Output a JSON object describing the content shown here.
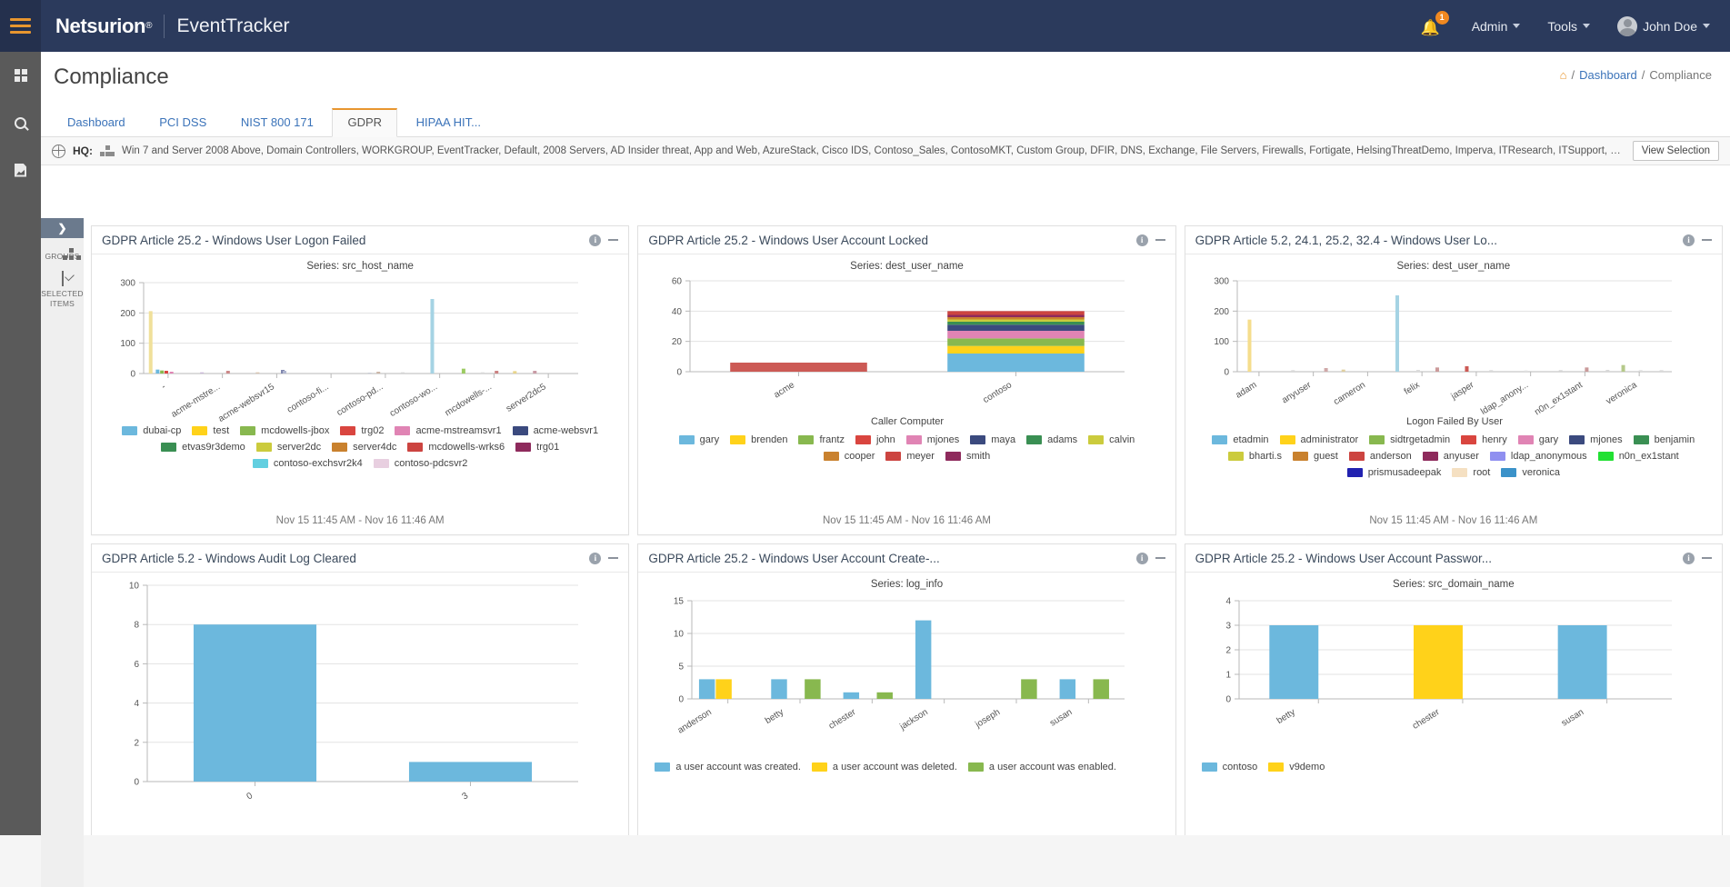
{
  "topbar": {
    "brand": "Netsurion",
    "brand_reg": "®",
    "product": "EventTracker",
    "notification_count": "1",
    "admin_label": "Admin",
    "tools_label": "Tools",
    "user_label": "John Doe"
  },
  "page": {
    "title": "Compliance",
    "breadcrumb_home": "⌂",
    "breadcrumb_sep1": "/",
    "breadcrumb_dashboard": "Dashboard",
    "breadcrumb_sep2": "/",
    "breadcrumb_current": "Compliance"
  },
  "tabs": [
    {
      "label": "Dashboard",
      "active": false
    },
    {
      "label": "PCI DSS",
      "active": false
    },
    {
      "label": "NIST 800 171",
      "active": false
    },
    {
      "label": "GDPR",
      "active": true
    },
    {
      "label": "HIPAA HIT...",
      "active": false
    }
  ],
  "filterbar": {
    "hq_label": "HQ:",
    "groups": "Win 7 and Server 2008 Above, Domain Controllers, WORKGROUP, EventTracker, Default, 2008 Servers, AD Insider threat, App and Web, AzureStack, Cisco IDS, Contoso_Sales, ContosoMKT, Custom Group, DFIR, DNS, Exchange, File Servers, Firewalls, Fortigate, HelsingThreatDemo, Imperva, ITResearch, ITSupport, Li...",
    "view_selection": "View Selection"
  },
  "subrail": {
    "expand": "❯",
    "groups_label": "GROUPS",
    "selected_items_label_1": "SELECTED",
    "selected_items_label_2": "ITEMS"
  },
  "colors": {
    "accent": "#e8962f",
    "navy": "#2b3a5c",
    "link": "#3b73b9",
    "blue": "#6cb8dd",
    "yellow": "#ffd21a"
  },
  "chart_data": [
    {
      "id": "w1",
      "type": "bar",
      "title": "GDPR Article 25.2 - Windows User Logon Failed",
      "subtitle": "Series: src_host_name",
      "xlabel": "",
      "ylabel": "",
      "ylim": [
        0,
        300
      ],
      "yticks": [
        0,
        100,
        200,
        300
      ],
      "grid": true,
      "legend_position": "bottom",
      "xticklabels": [
        "-",
        "acme-mstre...",
        "acme-websvr15",
        "contoso-fi...",
        "contoso-pd...",
        "contoso-wo...",
        "mcdowells-...",
        "server2dc5"
      ],
      "legend": [
        {
          "label": "dubai-cp",
          "color": "#6cb8dd"
        },
        {
          "label": "test",
          "color": "#ffd21a"
        },
        {
          "label": "mcdowells-jbox",
          "color": "#88b84f"
        },
        {
          "label": "trg02",
          "color": "#d9453f"
        },
        {
          "label": "acme-mstreamsvr1",
          "color": "#e084b4"
        },
        {
          "label": "acme-websvr1",
          "color": "#3b4a7e"
        },
        {
          "label": "etvas9r3demo",
          "color": "#3a8f53"
        },
        {
          "label": "server2dc",
          "color": "#cbcb3d"
        },
        {
          "label": "server4dc",
          "color": "#c9812e"
        },
        {
          "label": "mcdowells-wrks6",
          "color": "#cc4440"
        },
        {
          "label": "trg01",
          "color": "#8e2a5c"
        },
        {
          "label": "contoso-exchsvr2k4",
          "color": "#62cfe0"
        },
        {
          "label": "contoso-pdcsvr2",
          "color": "#e8cfe0"
        }
      ],
      "bars": [
        {
          "x": 6,
          "value": 206,
          "color": "#f0e09a"
        },
        {
          "x": 14,
          "value": 13,
          "color": "#6cb8dd"
        },
        {
          "x": 19,
          "value": 10,
          "color": "#88b84f"
        },
        {
          "x": 24,
          "value": 9,
          "color": "#d9453f"
        },
        {
          "x": 30,
          "value": 6,
          "color": "#e084b4"
        },
        {
          "x": 65,
          "value": 4,
          "color": "#c9b8d8"
        },
        {
          "x": 95,
          "value": 9,
          "color": "#cc8888"
        },
        {
          "x": 129,
          "value": 4,
          "color": "#d8c4b0"
        },
        {
          "x": 158,
          "value": 12,
          "color": "#7d84ad"
        },
        {
          "x": 160,
          "value": 9,
          "color": "#b0b6cf"
        },
        {
          "x": 218,
          "value": 3,
          "color": "#dcdcdc"
        },
        {
          "x": 258,
          "value": 3,
          "color": "#c9cdd8"
        },
        {
          "x": 268,
          "value": 6,
          "color": "#cbb6a8"
        },
        {
          "x": 296,
          "value": 4,
          "color": "#d5d5d5"
        },
        {
          "x": 330,
          "value": 246,
          "color": "#a5d3e4"
        },
        {
          "x": 366,
          "value": 16,
          "color": "#9ccb63"
        },
        {
          "x": 388,
          "value": 4,
          "color": "#d8d8d8"
        },
        {
          "x": 404,
          "value": 9,
          "color": "#cc8282"
        },
        {
          "x": 425,
          "value": 8,
          "color": "#e8d48a"
        },
        {
          "x": 448,
          "value": 9,
          "color": "#c99ba5"
        }
      ],
      "timerange": "Nov 15 11:45 AM - Nov 16 11:46 AM"
    },
    {
      "id": "w2",
      "type": "bar",
      "stacked": true,
      "title": "GDPR Article 25.2 - Windows User Account Locked",
      "subtitle": "Series: dest_user_name",
      "xlabel": "Caller Computer",
      "ylabel": "",
      "ylim": [
        0,
        60
      ],
      "yticks": [
        0,
        20,
        40,
        60
      ],
      "grid": true,
      "legend_position": "bottom",
      "categories": [
        "acme",
        "contoso"
      ],
      "legend": [
        {
          "label": "gary",
          "color": "#6cb8dd"
        },
        {
          "label": "brenden",
          "color": "#ffd21a"
        },
        {
          "label": "frantz",
          "color": "#88b84f"
        },
        {
          "label": "john",
          "color": "#d9453f"
        },
        {
          "label": "mjones",
          "color": "#e084b4"
        },
        {
          "label": "maya",
          "color": "#3b4a7e"
        },
        {
          "label": "adams",
          "color": "#3a8f53"
        },
        {
          "label": "calvin",
          "color": "#cbcb3d"
        },
        {
          "label": "cooper",
          "color": "#c9812e"
        },
        {
          "label": "meyer",
          "color": "#cc4440"
        },
        {
          "label": "smith",
          "color": "#8e2a5c"
        }
      ],
      "series": [
        {
          "name": "acme",
          "segments": [
            {
              "label": "john",
              "color": "#cc5a55",
              "value": 6
            }
          ]
        },
        {
          "name": "contoso",
          "segments": [
            {
              "label": "gary",
              "color": "#6cb8dd",
              "value": 12
            },
            {
              "label": "brenden",
              "color": "#ffd21a",
              "value": 5
            },
            {
              "label": "frantz",
              "color": "#88b84f",
              "value": 5
            },
            {
              "label": "mjones",
              "color": "#e084b4",
              "value": 5
            },
            {
              "label": "maya",
              "color": "#3b4a7e",
              "value": 4
            },
            {
              "label": "adams",
              "color": "#3a8f53",
              "value": 2
            },
            {
              "label": "calvin",
              "color": "#cbcb3d",
              "value": 1.5
            },
            {
              "label": "cooper",
              "color": "#c9812e",
              "value": 1.5
            },
            {
              "label": "smith",
              "color": "#8e2a5c",
              "value": 1.5
            },
            {
              "label": "meyer",
              "color": "#cc4440",
              "value": 2.5
            }
          ]
        }
      ],
      "timerange": "Nov 15 11:45 AM - Nov 16 11:46 AM"
    },
    {
      "id": "w3",
      "type": "bar",
      "title": "GDPR Article 5.2, 24.1, 25.2, 32.4 - Windows User Lo...",
      "subtitle": "Series: dest_user_name",
      "xlabel": "Logon Failed By User",
      "ylabel": "",
      "ylim": [
        0,
        300
      ],
      "yticks": [
        0,
        100,
        200,
        300
      ],
      "grid": true,
      "legend_position": "bottom",
      "xticklabels": [
        "adam",
        "anyuser",
        "cameron",
        "felix",
        "jasper",
        "ldap_anony...",
        "n0n_ex1stant",
        "veronica"
      ],
      "legend": [
        {
          "label": "etadmin",
          "color": "#6cb8dd"
        },
        {
          "label": "administrator",
          "color": "#ffd21a"
        },
        {
          "label": "sidtrgetadmin",
          "color": "#88b84f"
        },
        {
          "label": "henry",
          "color": "#d9453f"
        },
        {
          "label": "gary",
          "color": "#e084b4"
        },
        {
          "label": "mjones",
          "color": "#3b4a7e"
        },
        {
          "label": "benjamin",
          "color": "#3a8f53"
        },
        {
          "label": "bharti.s",
          "color": "#cbcb3d"
        },
        {
          "label": "guest",
          "color": "#c9812e"
        },
        {
          "label": "anderson",
          "color": "#cc4440"
        },
        {
          "label": "anyuser",
          "color": "#8e2a5c"
        },
        {
          "label": "ldap_anonymous",
          "color": "#8f8ff0"
        },
        {
          "label": "n0n_ex1stant",
          "color": "#22e033"
        },
        {
          "label": "prismusadeepak",
          "color": "#2222b0"
        },
        {
          "label": "root",
          "color": "#f5e0c2"
        },
        {
          "label": "veronica",
          "color": "#3b92c9"
        }
      ],
      "bars": [
        {
          "x": 12,
          "value": 172,
          "color": "#f5dd8c"
        },
        {
          "x": 62,
          "value": 5,
          "color": "#d8d8d8"
        },
        {
          "x": 100,
          "value": 12,
          "color": "#cfa8a8"
        },
        {
          "x": 120,
          "value": 7,
          "color": "#e0cfa0"
        },
        {
          "x": 182,
          "value": 252,
          "color": "#a5d3e4"
        },
        {
          "x": 206,
          "value": 6,
          "color": "#dcdcdc"
        },
        {
          "x": 228,
          "value": 14,
          "color": "#cc9a9a"
        },
        {
          "x": 262,
          "value": 18,
          "color": "#cc5a55"
        },
        {
          "x": 290,
          "value": 5,
          "color": "#d8d8d8"
        },
        {
          "x": 330,
          "value": 4,
          "color": "#e0e0e0"
        },
        {
          "x": 370,
          "value": 5,
          "color": "#d4d4d4"
        },
        {
          "x": 400,
          "value": 14,
          "color": "#c99a9a"
        },
        {
          "x": 424,
          "value": 6,
          "color": "#d8d8d8"
        },
        {
          "x": 442,
          "value": 22,
          "color": "#b5c98a"
        },
        {
          "x": 462,
          "value": 5,
          "color": "#dcdcdc"
        },
        {
          "x": 486,
          "value": 5,
          "color": "#d8d8d8"
        }
      ],
      "timerange": "Nov 15 11:45 AM - Nov 16 11:46 AM"
    },
    {
      "id": "w4",
      "type": "bar",
      "title": "GDPR Article 5.2 - Windows Audit Log Cleared",
      "subtitle": "",
      "xlabel": "",
      "ylabel": "",
      "ylim": [
        0,
        10
      ],
      "yticks": [
        0,
        2,
        4,
        6,
        8,
        10
      ],
      "grid": true,
      "legend_position": "none",
      "categories": [
        "0",
        "3"
      ],
      "values": [
        8,
        1
      ],
      "bar_color": "#6cb8dd",
      "legend": []
    },
    {
      "id": "w5",
      "type": "bar",
      "grouped": true,
      "title": "GDPR Article 25.2 - Windows User Account Create-...",
      "subtitle": "Series: log_info",
      "xlabel": "",
      "ylabel": "",
      "ylim": [
        0,
        15
      ],
      "yticks": [
        0,
        5,
        10,
        15
      ],
      "grid": true,
      "legend_position": "bottom",
      "categories": [
        "anderson",
        "betty",
        "chester",
        "jackson",
        "joseph",
        "susan"
      ],
      "legend": [
        {
          "label": "a user account was created.",
          "color": "#6cb8dd"
        },
        {
          "label": "a user account was deleted.",
          "color": "#ffd21a"
        },
        {
          "label": "a user account was enabled.",
          "color": "#88b84f"
        }
      ],
      "series": [
        {
          "name": "a user account was created.",
          "color": "#6cb8dd",
          "values": [
            3,
            3,
            1,
            12,
            0,
            3
          ]
        },
        {
          "name": "a user account was deleted.",
          "color": "#ffd21a",
          "values": [
            3,
            0,
            0,
            0,
            0,
            0
          ]
        },
        {
          "name": "a user account was enabled.",
          "color": "#88b84f",
          "values": [
            0,
            3,
            1,
            0,
            3,
            3
          ]
        }
      ]
    },
    {
      "id": "w6",
      "type": "bar",
      "title": "GDPR Article 25.2 - Windows User Account Passwor...",
      "subtitle": "Series: src_domain_name",
      "xlabel": "",
      "ylabel": "",
      "ylim": [
        0,
        4
      ],
      "yticks": [
        0,
        1,
        2,
        3,
        4
      ],
      "grid": true,
      "legend_position": "bottom",
      "categories": [
        "betty",
        "chester",
        "susan"
      ],
      "values": [
        3,
        3,
        3
      ],
      "bar_colors": [
        "#6cb8dd",
        "#ffd21a",
        "#6cb8dd"
      ],
      "legend": [
        {
          "label": "contoso",
          "color": "#6cb8dd"
        },
        {
          "label": "v9demo",
          "color": "#ffd21a"
        }
      ]
    }
  ]
}
